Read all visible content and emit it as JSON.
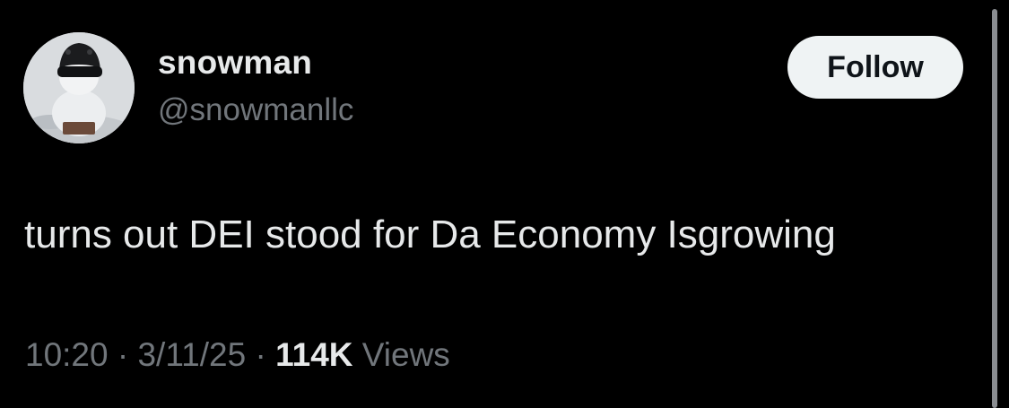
{
  "author": {
    "display_name": "snowman",
    "handle": "@snowmanllc",
    "avatar_icon": "snowman-photo-avatar"
  },
  "follow_button": {
    "label": "Follow"
  },
  "tweet": {
    "text": "turns out DEI stood for Da Economy Isgrowing"
  },
  "meta": {
    "time": "10:20",
    "separator_1": " · ",
    "date": "3/11/25",
    "separator_2": " · ",
    "views_count": "114K",
    "views_label": " Views"
  },
  "colors": {
    "background": "#000000",
    "primary_text": "#e7e9ea",
    "secondary_text": "#71767b",
    "follow_button_bg": "#eff3f4",
    "follow_button_text": "#0f1419"
  }
}
